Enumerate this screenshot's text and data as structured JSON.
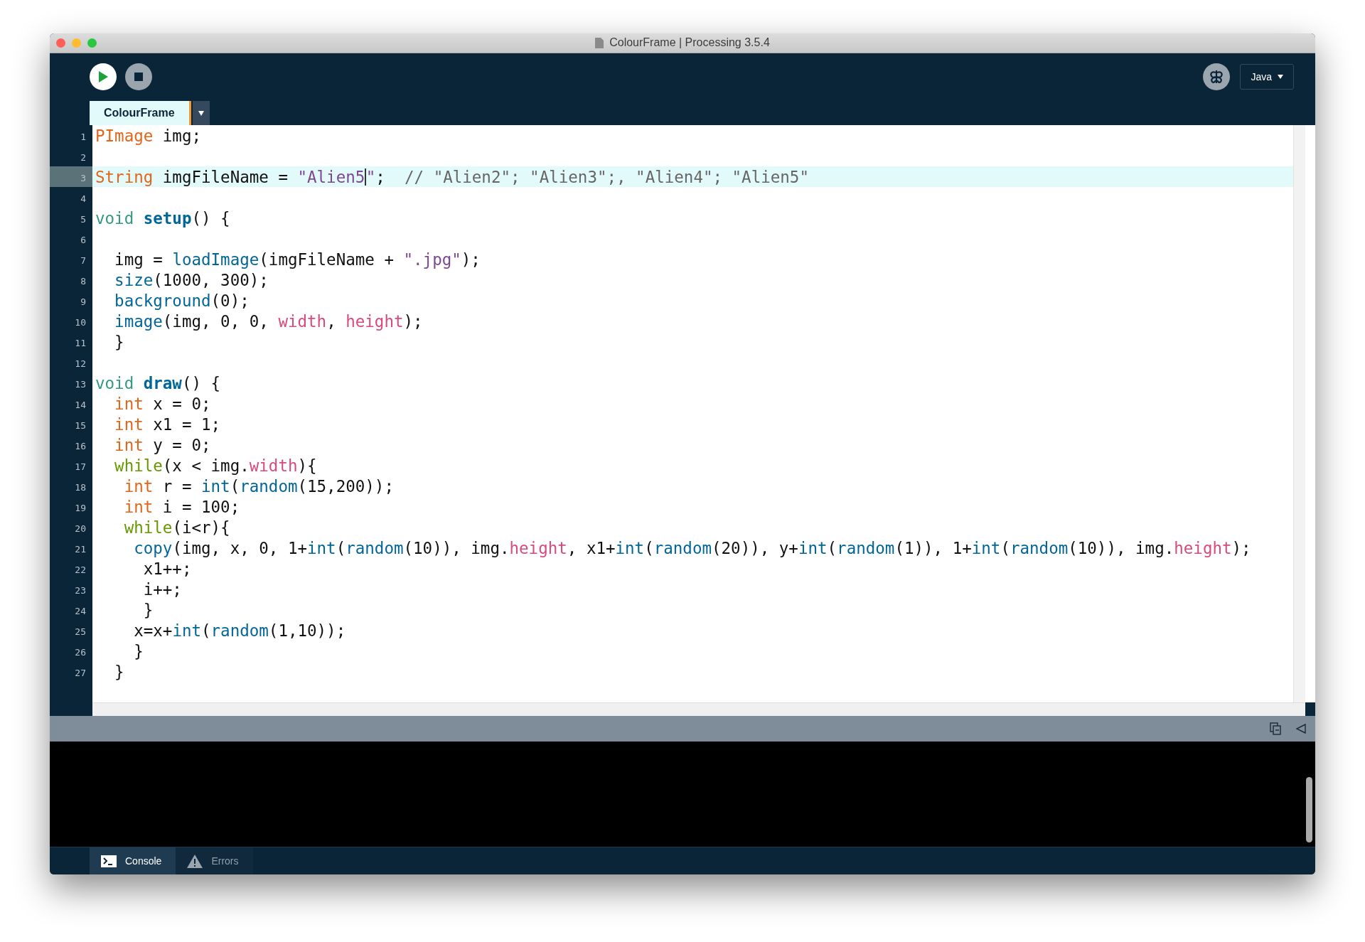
{
  "window": {
    "title": "ColourFrame | Processing 3.5.4"
  },
  "toolbar": {
    "mode": "Java"
  },
  "tabs": [
    {
      "label": "ColourFrame",
      "selected": true
    }
  ],
  "editor": {
    "lines": [
      {
        "number": "1",
        "current": false,
        "tokens": [
          {
            "kind": "type",
            "text": "PImage"
          },
          {
            "kind": "plain",
            "text": " img;"
          }
        ]
      },
      {
        "number": "2",
        "current": false
      },
      {
        "number": "3",
        "current": true,
        "tokens": [
          {
            "kind": "type",
            "text": "String"
          },
          {
            "kind": "plain",
            "text": " imgFileName = "
          },
          {
            "kind": "string",
            "text": "\"Alien5",
            "caret": true
          },
          {
            "kind": "string",
            "text": "\""
          },
          {
            "kind": "plain",
            "text": ";  "
          },
          {
            "kind": "comment",
            "text": "// \"Alien2\"; \"Alien3\";, \"Alien4\"; \"Alien5\""
          }
        ]
      },
      {
        "number": "4",
        "current": false
      },
      {
        "number": "5",
        "current": false,
        "tokens": [
          {
            "kind": "keyword",
            "text": "void "
          },
          {
            "kind": "function",
            "text": "setup"
          },
          {
            "kind": "plain",
            "text": "() {"
          }
        ]
      },
      {
        "number": "6",
        "current": false
      },
      {
        "number": "7",
        "current": false,
        "tokens": [
          {
            "kind": "plain",
            "text": "  img = "
          },
          {
            "kind": "builtin",
            "text": "loadImage"
          },
          {
            "kind": "plain",
            "text": "(imgFileName + "
          },
          {
            "kind": "string",
            "text": "\".jpg\""
          },
          {
            "kind": "plain",
            "text": ");"
          }
        ]
      },
      {
        "number": "8",
        "current": false,
        "tokens": [
          {
            "kind": "builtin",
            "text": "  size"
          },
          {
            "kind": "plain",
            "text": "(1000, 300);"
          }
        ]
      },
      {
        "number": "9",
        "current": false,
        "tokens": [
          {
            "kind": "builtin",
            "text": "  background"
          },
          {
            "kind": "plain",
            "text": "(0);"
          }
        ]
      },
      {
        "number": "10",
        "current": false,
        "tokens": [
          {
            "kind": "builtin",
            "text": "  image"
          },
          {
            "kind": "plain",
            "text": "(img, 0, 0, "
          },
          {
            "kind": "field",
            "text": "width"
          },
          {
            "kind": "plain",
            "text": ", "
          },
          {
            "kind": "field",
            "text": "height"
          },
          {
            "kind": "plain",
            "text": ");"
          }
        ]
      },
      {
        "number": "11",
        "current": false,
        "tokens": [
          {
            "kind": "plain",
            "text": "  }"
          }
        ]
      },
      {
        "number": "12",
        "current": false
      },
      {
        "number": "13",
        "current": false,
        "tokens": [
          {
            "kind": "keyword",
            "text": "void "
          },
          {
            "kind": "function",
            "text": "draw"
          },
          {
            "kind": "plain",
            "text": "() {"
          }
        ]
      },
      {
        "number": "14",
        "current": false,
        "tokens": [
          {
            "kind": "type",
            "text": "  int"
          },
          {
            "kind": "plain",
            "text": " x = 0;"
          }
        ]
      },
      {
        "number": "15",
        "current": false,
        "tokens": [
          {
            "kind": "type",
            "text": "  int"
          },
          {
            "kind": "plain",
            "text": " x1 = 1;"
          }
        ]
      },
      {
        "number": "16",
        "current": false,
        "tokens": [
          {
            "kind": "type",
            "text": "  int"
          },
          {
            "kind": "plain",
            "text": " y = 0;"
          }
        ]
      },
      {
        "number": "17",
        "current": false,
        "tokens": [
          {
            "kind": "control",
            "text": "  while"
          },
          {
            "kind": "plain",
            "text": "(x < img."
          },
          {
            "kind": "field",
            "text": "width"
          },
          {
            "kind": "plain",
            "text": "){"
          }
        ]
      },
      {
        "number": "18",
        "current": false,
        "tokens": [
          {
            "kind": "type",
            "text": "   int"
          },
          {
            "kind": "plain",
            "text": " r = "
          },
          {
            "kind": "builtin",
            "text": "int"
          },
          {
            "kind": "plain",
            "text": "("
          },
          {
            "kind": "builtin",
            "text": "random"
          },
          {
            "kind": "plain",
            "text": "(15,200));"
          }
        ]
      },
      {
        "number": "19",
        "current": false,
        "tokens": [
          {
            "kind": "type",
            "text": "   int"
          },
          {
            "kind": "plain",
            "text": " i = 100;"
          }
        ]
      },
      {
        "number": "20",
        "current": false,
        "tokens": [
          {
            "kind": "control",
            "text": "   while"
          },
          {
            "kind": "plain",
            "text": "(i<r){"
          }
        ]
      },
      {
        "number": "21",
        "current": false,
        "tokens": [
          {
            "kind": "builtin",
            "text": "    copy"
          },
          {
            "kind": "plain",
            "text": "(img, x, 0, 1+"
          },
          {
            "kind": "builtin",
            "text": "int"
          },
          {
            "kind": "plain",
            "text": "("
          },
          {
            "kind": "builtin",
            "text": "random"
          },
          {
            "kind": "plain",
            "text": "(10)), img."
          },
          {
            "kind": "field",
            "text": "height"
          },
          {
            "kind": "plain",
            "text": ", x1+"
          },
          {
            "kind": "builtin",
            "text": "int"
          },
          {
            "kind": "plain",
            "text": "("
          },
          {
            "kind": "builtin",
            "text": "random"
          },
          {
            "kind": "plain",
            "text": "(20)), y+"
          },
          {
            "kind": "builtin",
            "text": "int"
          },
          {
            "kind": "plain",
            "text": "("
          },
          {
            "kind": "builtin",
            "text": "random"
          },
          {
            "kind": "plain",
            "text": "(1)), 1+"
          },
          {
            "kind": "builtin",
            "text": "int"
          },
          {
            "kind": "plain",
            "text": "("
          },
          {
            "kind": "builtin",
            "text": "random"
          },
          {
            "kind": "plain",
            "text": "(10)), img."
          },
          {
            "kind": "field",
            "text": "height"
          },
          {
            "kind": "plain",
            "text": ");"
          }
        ]
      },
      {
        "number": "22",
        "current": false,
        "tokens": [
          {
            "kind": "plain",
            "text": "     x1++;"
          }
        ]
      },
      {
        "number": "23",
        "current": false,
        "tokens": [
          {
            "kind": "plain",
            "text": "     i++;"
          }
        ]
      },
      {
        "number": "24",
        "current": false,
        "tokens": [
          {
            "kind": "plain",
            "text": "     }"
          }
        ]
      },
      {
        "number": "25",
        "current": false,
        "tokens": [
          {
            "kind": "plain",
            "text": "    x=x+"
          },
          {
            "kind": "builtin",
            "text": "int"
          },
          {
            "kind": "plain",
            "text": "("
          },
          {
            "kind": "builtin",
            "text": "random"
          },
          {
            "kind": "plain",
            "text": "(1,10));"
          }
        ]
      },
      {
        "number": "26",
        "current": false,
        "tokens": [
          {
            "kind": "plain",
            "text": "    }"
          }
        ]
      },
      {
        "number": "27",
        "current": false,
        "tokens": [
          {
            "kind": "plain",
            "text": "  }"
          }
        ]
      }
    ]
  },
  "bottom_tabs": [
    {
      "label": "Console",
      "kind": "console",
      "selected": true
    },
    {
      "label": "Errors",
      "kind": "errors",
      "selected": false
    }
  ]
}
